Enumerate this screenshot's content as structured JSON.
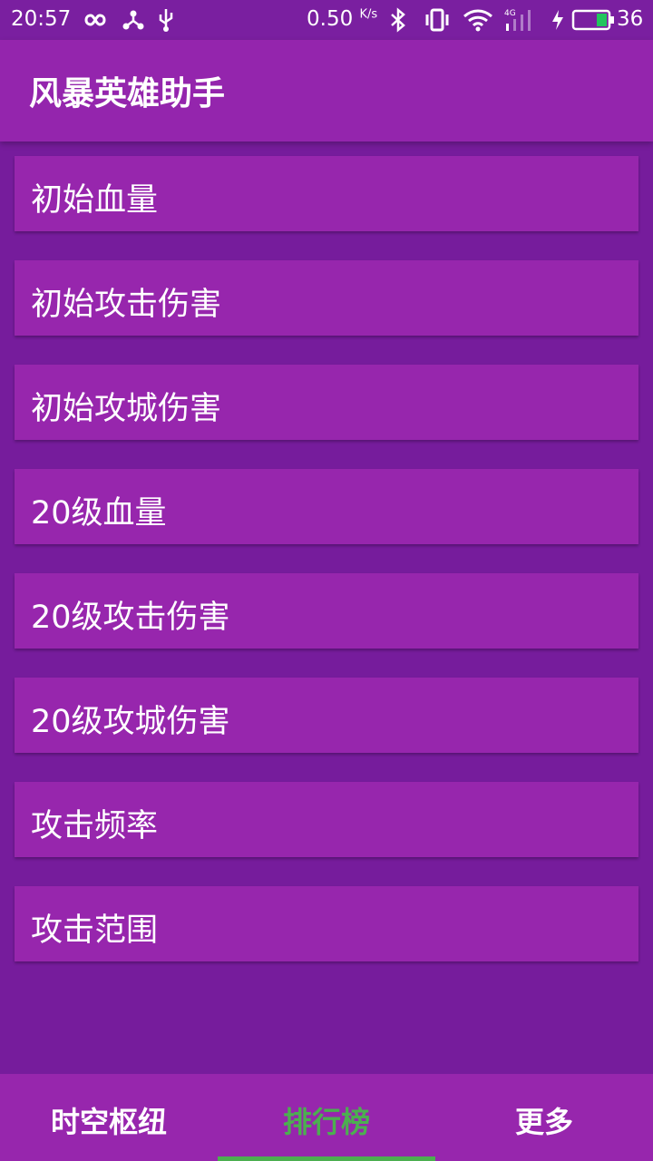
{
  "status_bar": {
    "time": "20:57",
    "speed_value": "0.50",
    "speed_unit": "K/s",
    "battery_level": "36",
    "icons": [
      "infinity-icon",
      "share-hub-icon",
      "usb-icon",
      "bluetooth-icon",
      "vibrate-icon",
      "wifi-icon",
      "signal-4g-icon",
      "charging-icon",
      "battery-icon"
    ]
  },
  "app_bar": {
    "title": "风暴英雄助手"
  },
  "list": {
    "items": [
      {
        "label": "初始血量"
      },
      {
        "label": "初始攻击伤害"
      },
      {
        "label": "初始攻城伤害"
      },
      {
        "label": "20级血量"
      },
      {
        "label": "20级攻击伤害"
      },
      {
        "label": "20级攻城伤害"
      },
      {
        "label": "攻击频率"
      },
      {
        "label": "攻击范围"
      }
    ]
  },
  "bottom_nav": {
    "tabs": [
      {
        "label": "时空枢纽",
        "active": false
      },
      {
        "label": "排行榜",
        "active": true
      },
      {
        "label": "更多",
        "active": false
      }
    ]
  },
  "colors": {
    "background": "#761c9c",
    "app_bar": "#9425ad",
    "card": "#9726ad",
    "accent": "#4caf50"
  }
}
